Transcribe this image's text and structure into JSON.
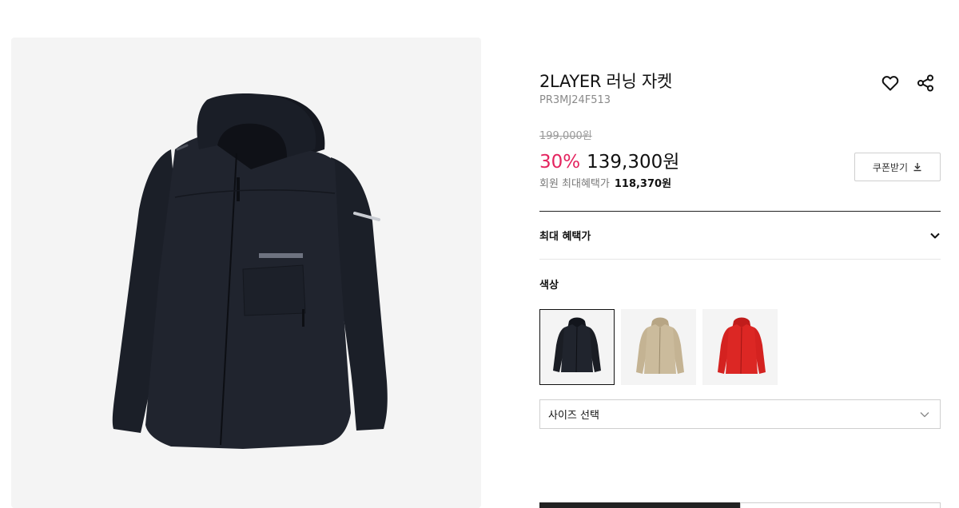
{
  "product": {
    "title": "2LAYER 러닝 자켓",
    "code": "PR3MJ24F513",
    "original_price": "199,000원",
    "discount": "30%",
    "sale_price": "139,300원",
    "member_label": "회원 최대혜택가",
    "member_price": "118,370원"
  },
  "actions": {
    "coupon_label": "쿠폰받기",
    "wishlist_icon": "heart-icon",
    "share_icon": "share-icon",
    "coupon_icon": "download-icon"
  },
  "benefit": {
    "label": "최대 혜택가",
    "icon": "chevron-down-icon"
  },
  "color_section": {
    "label": "색상",
    "options": [
      {
        "name": "black",
        "color": "#1a1d24",
        "selected": true
      },
      {
        "name": "beige",
        "color": "#c9b89a",
        "selected": false
      },
      {
        "name": "red",
        "color": "#d9211f",
        "selected": false
      }
    ]
  },
  "size_select": {
    "placeholder": "사이즈 선택",
    "icon": "chevron-down-icon"
  },
  "colors": {
    "accent_discount": "#e4245f",
    "image_bg": "#f4f4f4"
  }
}
